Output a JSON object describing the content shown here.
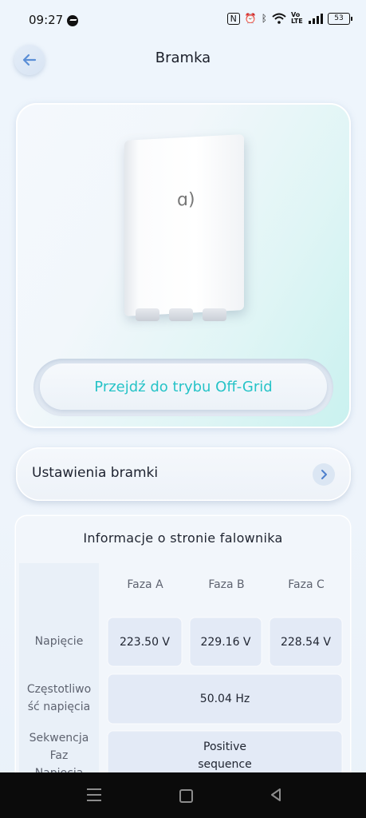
{
  "status_bar": {
    "time": "09:27",
    "network": "Vo LTE",
    "battery": "53"
  },
  "header": {
    "title": "Bramka"
  },
  "hero": {
    "device_logo": "ɑ)",
    "offgrid_button": "Przejdź do trybu Off-Grid"
  },
  "settings": {
    "label": "Ustawienia bramki"
  },
  "info": {
    "title": "Informacje o stronie falownika",
    "phases": [
      "Faza A",
      "Faza B",
      "Faza C"
    ],
    "voltage_label": "Napięcie",
    "voltages": [
      "223.50 V",
      "229.16 V",
      "228.54 V"
    ],
    "frequency_label": "Częstotliwo ść napięcia",
    "frequency": "50.04 Hz",
    "sequence_label": "Sekwencja Faz Napięcia",
    "sequence": "Positive sequence"
  },
  "colors": {
    "accent": "#26c3c7",
    "background": "#eef5fc",
    "cell": "#e3eaf6"
  }
}
